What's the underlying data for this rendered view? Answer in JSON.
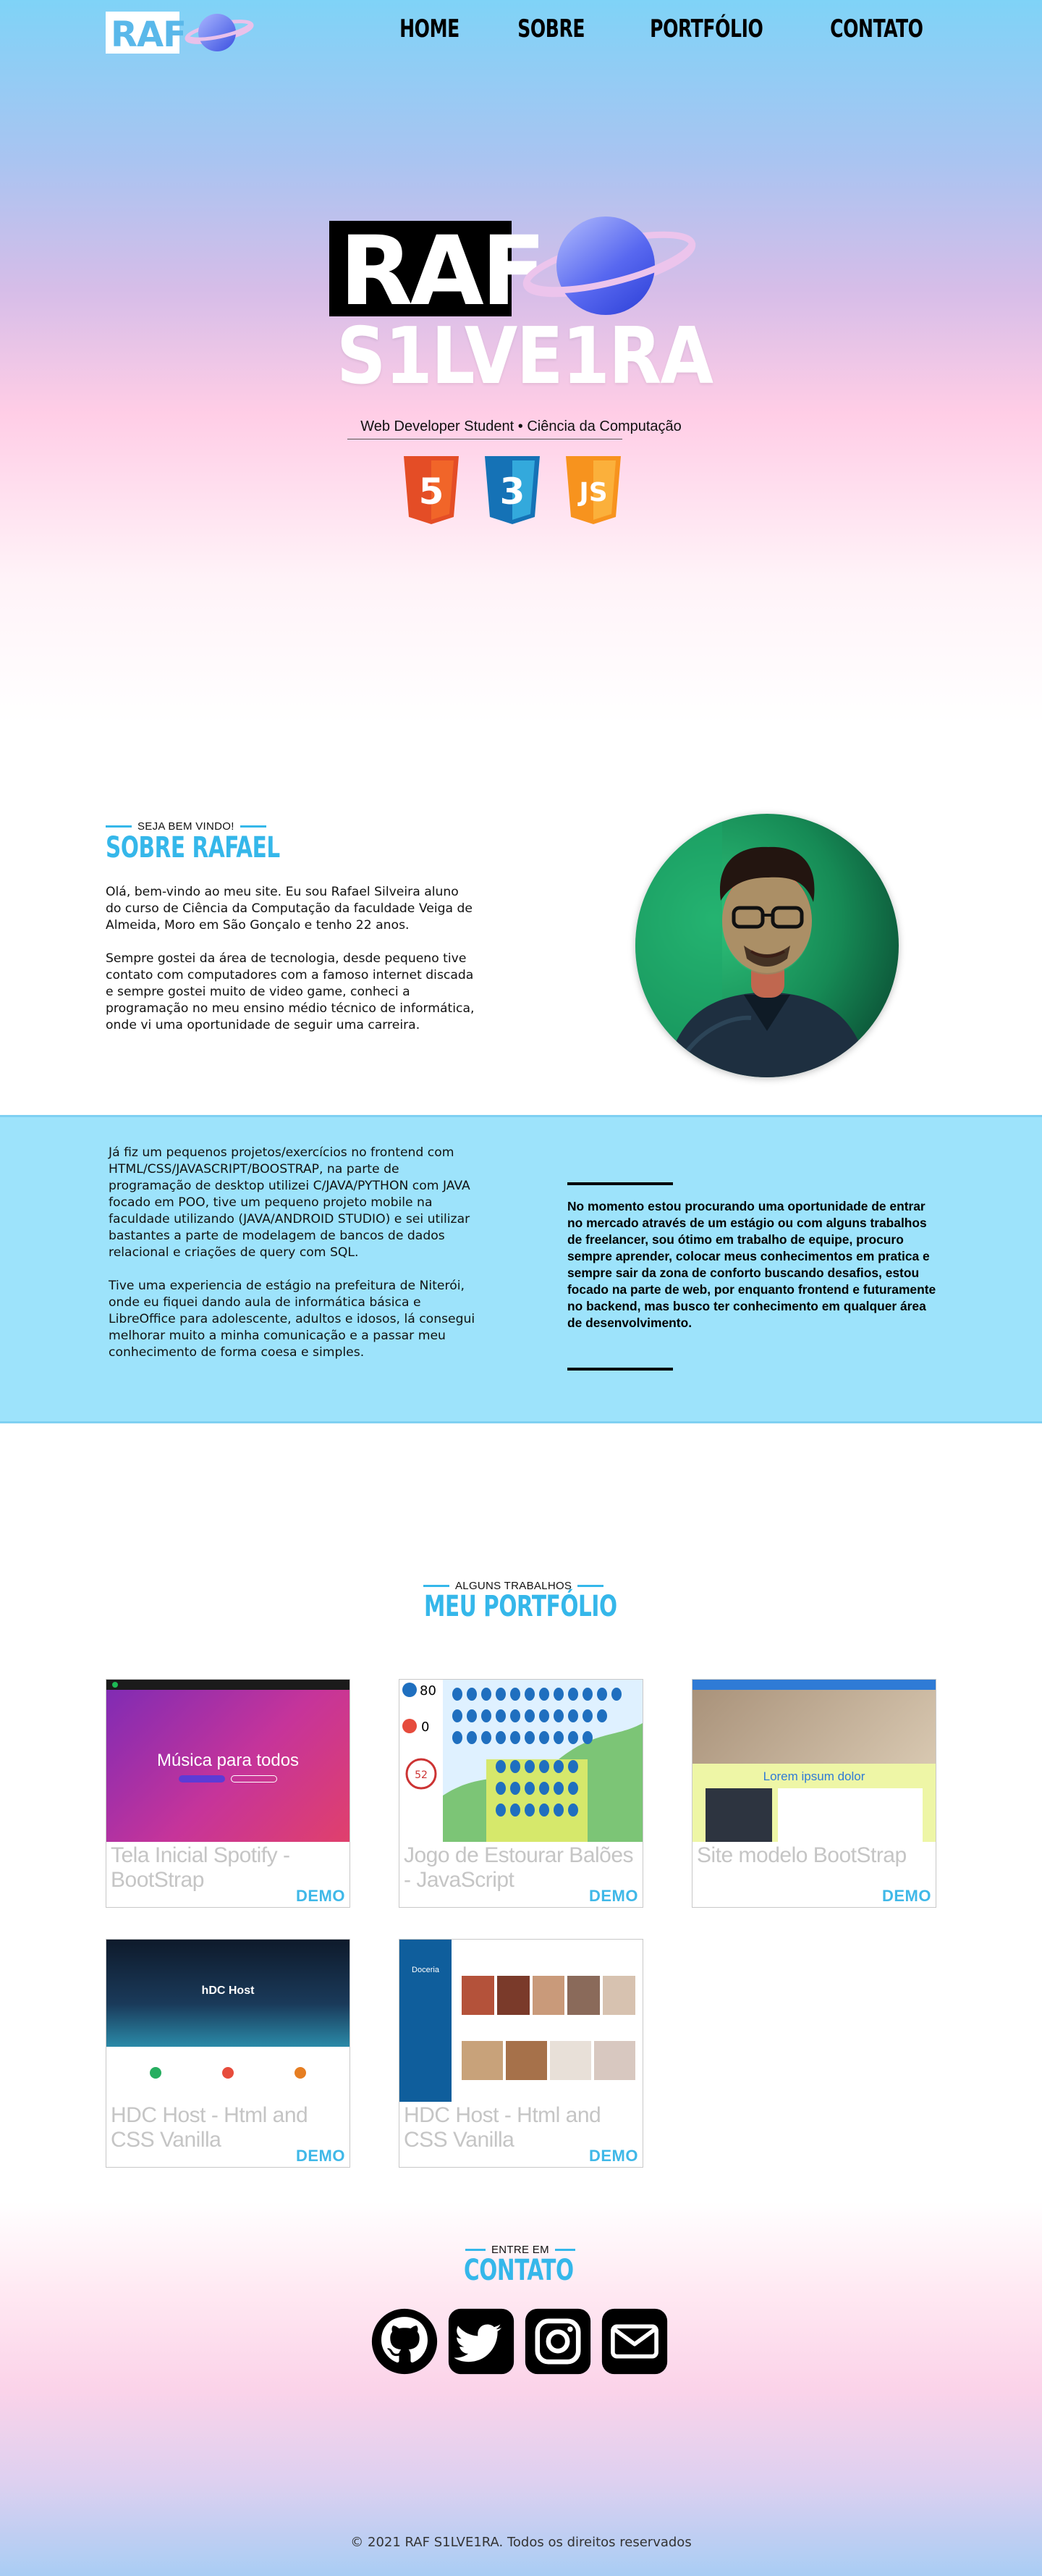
{
  "nav": {
    "logo_text": "RAF",
    "items": [
      {
        "label": "HOME"
      },
      {
        "label": "SOBRE"
      },
      {
        "label": "PORTFÓLIO"
      },
      {
        "label": "CONTATO"
      }
    ]
  },
  "hero": {
    "logo_top": "RAF",
    "logo_bottom": "S1LVE1RA",
    "subtitle": "Web Developer Student  •  Ciência da Computação",
    "tech": [
      "html5-shield-icon",
      "css3-shield-icon",
      "javascript-shield-icon"
    ],
    "tech_glyphs": {
      "html": "5",
      "css": "3",
      "js": "JS"
    }
  },
  "about": {
    "eyebrow": "SEJA BEM VINDO!",
    "title": "SOBRE RAFAEL",
    "paragraphs": [
      "Olá, bem-vindo ao meu site. Eu sou Rafael Silveira aluno do curso de Ciência da Computação da faculdade Veiga de Almeida, Moro em São Gonçalo e tenho 22 anos.",
      "Sempre gostei da área de tecnologia, desde pequeno tive contato com computadores com a famoso internet discada e sempre gostei muito de video game, conheci a programação no meu ensino médio técnico de informática, onde vi uma oportunidade de seguir uma carreira."
    ]
  },
  "band": {
    "left_paragraphs": [
      "Já fiz um pequenos projetos/exercícios no frontend com HTML/CSS/JAVASCRIPT/BOOSTRAP, na parte de programação de desktop utilizei C/JAVA/PYTHON com JAVA focado em POO, tive um pequeno projeto mobile na faculdade utilizando (JAVA/ANDROID STUDIO) e sei utilizar bastantes a parte de modelagem de bancos de dados relacional e criações de query com SQL.",
      "Tive uma experiencia de estágio na prefeitura de Niterói, onde eu fiquei dando aula de informática básica e LibreOffice para adolescente, adultos e idosos, lá consegui melhorar muito a minha comunicação e a passar meu conhecimento de forma coesa e simples."
    ],
    "right_text": "No momento estou procurando uma oportunidade de entrar no mercado através de um estágio ou com alguns trabalhos de freelancer, sou ótimo em trabalho de equipe, procuro sempre aprender, colocar meus conhecimentos em pratica e sempre sair da zona de conforto buscando desafios, estou focado na parte de web, por enquanto frontend e futuramente no backend, mas busco ter conhecimento em qualquer área de desenvolvimento."
  },
  "portfolio": {
    "eyebrow": "ALGUNS TRABALHOS",
    "title": "MEU PORTFÓLIO",
    "cards": [
      {
        "title": "Tela Inicial Spotify - BootStrap",
        "demo": "DEMO",
        "thumb_text": "Música para todos"
      },
      {
        "title": "Jogo de Estourar Balões - JavaScript",
        "demo": "DEMO",
        "thumb_score_a": "80",
        "thumb_score_b": "0",
        "thumb_timer": "52"
      },
      {
        "title": "Site modelo BootStrap",
        "demo": "DEMO",
        "thumb_text": "Lorem ipsum dolor"
      },
      {
        "title": "HDC Host - Html and CSS Vanilla",
        "demo": "DEMO",
        "thumb_text": "hDC Host"
      },
      {
        "title": "HDC Host - Html and CSS Vanilla",
        "demo": "DEMO",
        "thumb_text": "Doceria"
      }
    ]
  },
  "contact": {
    "eyebrow": "ENTRE EM",
    "title": "CONTATO",
    "socials": [
      "github-icon",
      "twitter-icon",
      "instagram-icon",
      "email-icon"
    ]
  },
  "footer": {
    "text": "© 2021 RAF S1LVE1RA. Todos os direitos reservados"
  },
  "colors": {
    "accent": "#35b7ea",
    "band": "#9de3fb",
    "html5": "#e44d26",
    "css3": "#1572b6",
    "js": "#f7931e"
  }
}
